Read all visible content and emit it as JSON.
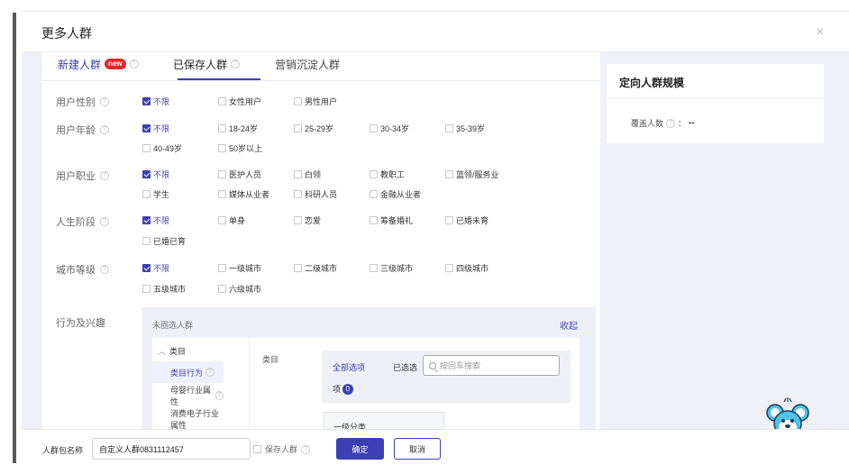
{
  "modal": {
    "title": "更多人群",
    "close_icon": "×"
  },
  "tabs": [
    {
      "label": "新建人群",
      "badge": "new"
    },
    {
      "label": "已保存人群"
    },
    {
      "label": "营销沉淀人群"
    }
  ],
  "help_icon": "?",
  "filters": {
    "gender": {
      "label": "用户性别",
      "options": [
        "不限",
        "女性用户",
        "男性用户"
      ],
      "selected": "不限"
    },
    "age": {
      "label": "用户年龄",
      "options": [
        "不限",
        "18-24岁",
        "25-29岁",
        "30-34岁",
        "35-39岁",
        "40-49岁",
        "50岁以上"
      ],
      "selected": "不限"
    },
    "job": {
      "label": "用户职业",
      "options": [
        "不限",
        "医护人员",
        "白领",
        "教职工",
        "蓝领/服务业",
        "学生",
        "媒体从业者",
        "科研人员",
        "金融从业者"
      ],
      "selected": "不限"
    },
    "life": {
      "label": "人生阶段",
      "options": [
        "不限",
        "单身",
        "恋爱",
        "筹备婚礼",
        "已婚未育",
        "已婚已育"
      ],
      "selected": "不限"
    },
    "city": {
      "label": "城市等级",
      "options": [
        "不限",
        "一级城市",
        "二级城市",
        "三级城市",
        "四级城市",
        "五级城市",
        "六级城市"
      ],
      "selected": "不限"
    }
  },
  "behavior": {
    "label": "行为及兴趣",
    "box_title": "未圈选人群",
    "collapse": "收起",
    "category_head": "类目",
    "categories": [
      "类目行为",
      "母婴行业属性",
      "消费电子行业属性"
    ],
    "mid_label": "类目",
    "all_options": "全部选项",
    "selected_label": "已选选",
    "search_placeholder": "按回车搜索",
    "item_suffix": "项",
    "selected_count": "0",
    "level1": "一级分类"
  },
  "right_panel": {
    "title": "定向人群规模",
    "cover_label": "覆盖人数",
    "cover_sep": "：",
    "cover_value": "--"
  },
  "footer": {
    "name_label": "人群包名称",
    "name_value": "自定义人群0831112457",
    "save_label": "保存人群",
    "ok_label": "确定",
    "cancel_label": "取消"
  },
  "colors": {
    "accent": "#3d3fb5",
    "badge": "#e8262a"
  }
}
